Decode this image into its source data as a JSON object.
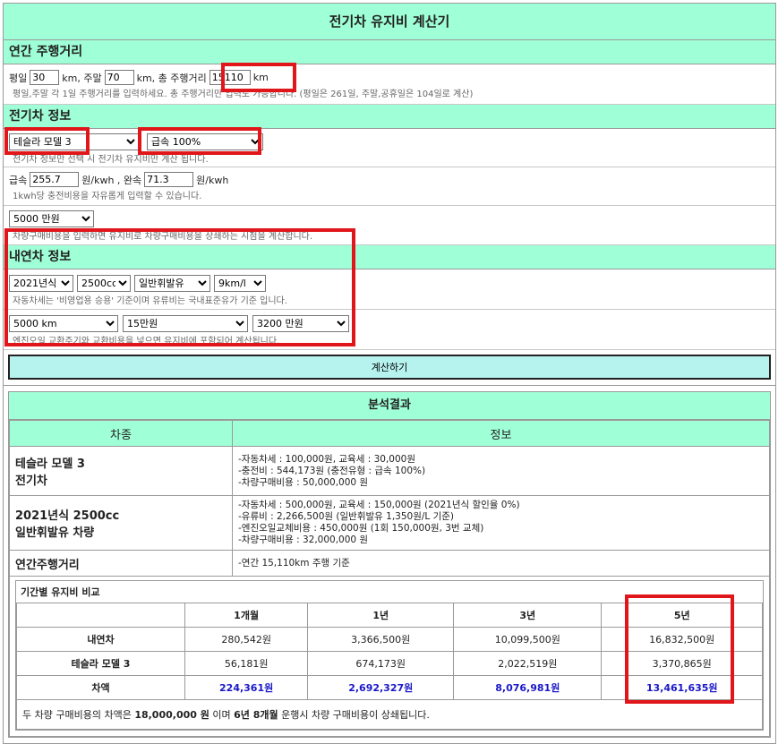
{
  "title": "전기차 유지비 계산기",
  "mileage": {
    "header": "연간 주행거리",
    "weekday_label": "평일",
    "weekday_value": "30",
    "km_weekend_label": "km, 주말",
    "weekend_value": "70",
    "total_label": "km, 총 주행거리",
    "total_value": "15110",
    "km": "km",
    "hint": "평일,주말 각 1일 주행거리를 입력하세요. 총 주행거리만 입력도 가능합니다. (평일은 261일, 주말,공휴일은 104일로 계산)"
  },
  "ev": {
    "header": "전기차 정보",
    "model_selected": "테슬라 모델 3",
    "charge_selected": "급속 100%",
    "hint1": "전기차 정보만 선택 시 전기차 유지비만 계산 됩니다.",
    "fast_label": "급속",
    "fast_value": "255.7",
    "per_kwh_slow": "원/kwh , 완속",
    "slow_value": "71.3",
    "per_kwh": "원/kwh",
    "hint2": "1kwh당 충전비용을 자유롭게 입력할 수 있습니다.",
    "price_selected": "5000 만원",
    "hint3": "차량구매비용을 입력하면 유지비로 차량구매비용을 상쇄하는 시점을 계산합니다."
  },
  "ice": {
    "header": "내연차 정보",
    "year_selected": "2021년식",
    "cc_selected": "2500cc",
    "fuel_selected": "일반휘발유",
    "eff_selected": "9km/l",
    "hint1": "자동차세는 '비영업용 승용' 기준이며 유류비는 국내표준유가 기준 입니다.",
    "oil_interval_selected": "5000 km",
    "oil_cost_selected": "15만원",
    "price_selected": "3200 만원",
    "hint2": "엔진오일 교환주기와 교환비용을 넣으면 유지비에 포함되어 계산됩니다."
  },
  "calc_button": "계산하기",
  "result": {
    "header": "분석결과",
    "col_car": "차종",
    "col_info": "정보",
    "ev_name1": "테슬라 모델 3",
    "ev_name2": "전기차",
    "ev_info": [
      "-자동차세 : 100,000원, 교육세 : 30,000원",
      "-충전비 : 544,173원 (충전유형 : 급속 100%)",
      "-차량구매비용 : 50,000,000 원"
    ],
    "ice_name1": "2021년식 2500cc",
    "ice_name2": "일반휘발유 차량",
    "ice_info": [
      "-자동차세 : 500,000원, 교육세 : 150,000원 (2021년식 할인율 0%)",
      "-유류비 : 2,266,500원 (일반휘발유 1,350원/L 기준)",
      "-엔진오일교체비용 : 450,000원 (1회 150,000원, 3번 교체)",
      "-차량구매비용 : 32,000,000 원"
    ],
    "mileage_name": "연간주행거리",
    "mileage_info": "-연간 15,110km 주행 기준"
  },
  "period": {
    "title": "기간별 유지비 비교",
    "headers": [
      "1개월",
      "1년",
      "3년",
      "5년"
    ],
    "rows": [
      {
        "label": "내연차",
        "values": [
          "280,542원",
          "3,366,500원",
          "10,099,500원",
          "16,832,500원"
        ]
      },
      {
        "label": "테슬라 모델 3",
        "values": [
          "56,181원",
          "674,173원",
          "2,022,519원",
          "3,370,865원"
        ]
      },
      {
        "label": "차액",
        "values": [
          "224,361원",
          "2,692,327원",
          "8,076,981원",
          "13,461,635원"
        ]
      }
    ],
    "footer_a": "두 차량 구매비용의 차액은 ",
    "footer_b": "18,000,000 원",
    "footer_c": " 이며 ",
    "footer_d": "6년 8개월",
    "footer_e": " 운행시 차량 구매비용이 상쇄됩니다."
  },
  "colors": {
    "accent_bg": "#9fffd6",
    "highlight": "#e1161b",
    "diff_text": "#1a18c8",
    "button_bg": "#b6f2ee"
  }
}
